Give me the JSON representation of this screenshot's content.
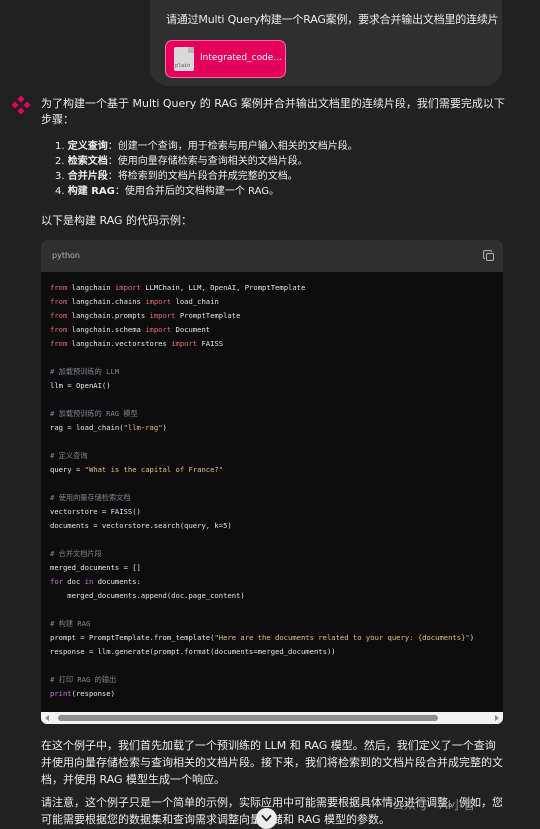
{
  "user_message": {
    "text": "请通过Multi Query构建一个RAG案例，要求合并输出文档里的连续片",
    "attachment": {
      "name": "Integrated_code...",
      "ext": "plain"
    }
  },
  "assistant": {
    "intro": "为了构建一个基于 Multi Query 的 RAG 案例并合并输出文档里的连续片段，我们需要完成以下步骤：",
    "steps": [
      {
        "num": "1.",
        "bold": "定义查询",
        "text": "：创建一个查询，用于检索与用户输入相关的文档片段。"
      },
      {
        "num": "2.",
        "bold": "检索文档",
        "text": "：使用向量存储检索与查询相关的文档片段。"
      },
      {
        "num": "3.",
        "bold": "合并片段",
        "text": "：将检索到的文档片段合并成完整的文档。"
      },
      {
        "num": "4.",
        "bold": "构建 RAG",
        "text": "：使用合并后的文档构建一个 RAG。"
      }
    ],
    "example_label": "以下是构建 RAG 的代码示例：",
    "code_language": "python",
    "code_lines": [
      "from langchain import LLMChain, LLM, OpenAI, PromptTemplate",
      "from langchain.chains import load_chain",
      "from langchain.prompts import PromptTemplate",
      "from langchain.schema import Document",
      "from langchain.vectorstores import FAISS",
      "",
      "# 加载预训练的 LLM",
      "llm = OpenAI()",
      "",
      "# 加载预训练的 RAG 模型",
      "rag = load_chain(\"llm-rag\")",
      "",
      "# 定义查询",
      "query = \"What is the capital of France?\"",
      "",
      "# 使用向量存储检索文档",
      "vectorstore = FAISS()",
      "documents = vectorstore.search(query, k=5)",
      "",
      "# 合并文档片段",
      "merged_documents = []",
      "for doc in documents:",
      "    merged_documents.append(doc.page_content)",
      "",
      "# 构建 RAG",
      "prompt = PromptTemplate.from_template(\"Here are the documents related to your query: {documents}\")",
      "response = llm.generate(prompt.format(documents=merged_documents))",
      "",
      "# 打印 RAG 的输出",
      "print(response)"
    ],
    "para1": "在这个例子中，我们首先加载了一个预训练的 LLM 和 RAG 模型。然后，我们定义了一个查询并使用向量存储检索与查询相关的文档片段。接下来，我们将检索到的文档片段合并成完整的文档，并使用 RAG 模型生成一个响应。",
    "para2": "请注意，这个例子只是一个简单的示例，实际应用中可能需要根据具体情况进行调整。例如，您可能需要根据您的数据集和查询需求调整向量存储和 RAG 模型的参数。"
  },
  "watermark": "公众号 · AI小智",
  "colors": {
    "accent": "#e4005a",
    "background": "#212121",
    "code_bg": "#0d0d0d"
  }
}
